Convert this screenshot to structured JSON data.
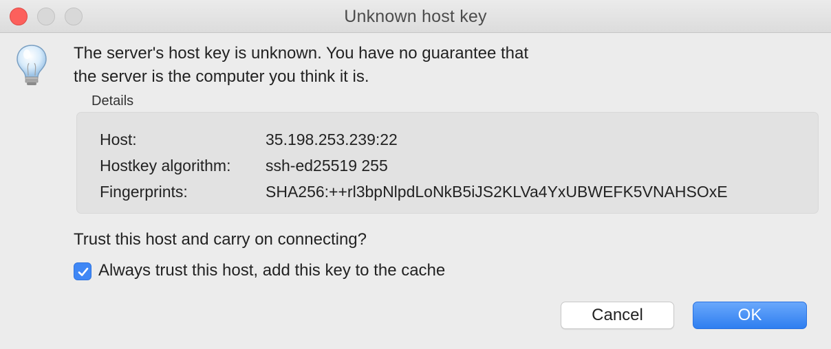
{
  "window": {
    "title": "Unknown host key",
    "buttons": [
      "close",
      "minimize",
      "maximize"
    ]
  },
  "icon": "lightbulb-icon",
  "message": {
    "line1": "The server's host key is unknown. You have no guarantee that",
    "line2": "the server is the computer you think it is."
  },
  "details": {
    "label": "Details",
    "rows": [
      {
        "key": "Host:",
        "value": "35.198.253.239:22"
      },
      {
        "key": "Hostkey algorithm:",
        "value": "ssh-ed25519 255"
      },
      {
        "key": "Fingerprints:",
        "value": "SHA256:++rl3bpNlpdLoNkB5iJS2KLVa4YxUBWEFK5VNAHSOxE"
      }
    ]
  },
  "question": "Trust this host and carry on connecting?",
  "always_trust": {
    "label": "Always trust this host, add this key to the cache",
    "checked": true
  },
  "actions": {
    "cancel_label": "Cancel",
    "ok_label": "OK"
  },
  "colors": {
    "accent": "#3f87f5",
    "close_button": "#fc605c",
    "background": "#ececec"
  }
}
